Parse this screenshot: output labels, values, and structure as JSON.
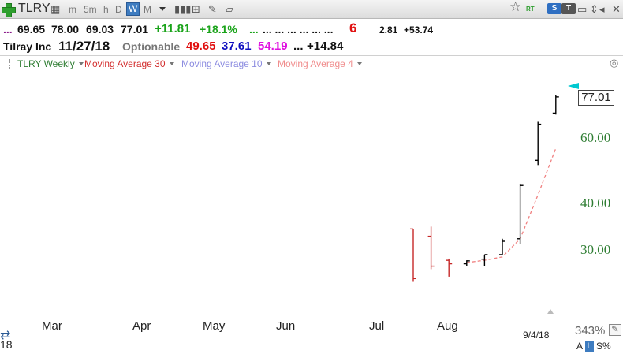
{
  "toolbar": {
    "symbol": "TLRY",
    "periods": [
      "m",
      "5m",
      "h",
      "D",
      "W",
      "M"
    ],
    "active_period": "W",
    "badges": {
      "rt": "RT",
      "s": "S",
      "t": "T"
    }
  },
  "quote": {
    "dots": "...",
    "open": "69.65",
    "high": "78.00",
    "low": "69.03",
    "close": "77.01",
    "change": "+11.81",
    "change_pct": "+18.1%",
    "dots_green": "...",
    "dots_mid": "... ... ... ... ... ...",
    "rank": "6",
    "val1": "2.81",
    "val2": "+53.74"
  },
  "info": {
    "company": "Tilray Inc",
    "date": "11/27/18",
    "tag": "Optionable",
    "v1": "49.65",
    "v2": "37.61",
    "v3": "54.19",
    "dots": "...",
    "v4": "+14.84"
  },
  "indicators": [
    {
      "label": "TLRY Weekly",
      "color": "#2e7d32"
    },
    {
      "label": "Moving Average 30",
      "color": "#d32f2f"
    },
    {
      "label": "Moving Average 10",
      "color": "#8c8ce0"
    },
    {
      "label": "Moving Average 4",
      "color": "#f08c8c"
    }
  ],
  "colors": {
    "up": "#000000",
    "down": "#c62828",
    "ma4": "#f08080",
    "axis_label": "#2e7d32",
    "price_marker": "#00c8d0",
    "green": "#1aa31a",
    "red": "#e01010",
    "blue": "#1010c0",
    "magenta": "#e010e0",
    "purple": "#8a1a8a"
  },
  "chart_data": {
    "type": "ohlc",
    "scale": "log",
    "ylim": [
      24,
      90
    ],
    "y_ticks": [
      "30.00",
      "40.00",
      "60.00"
    ],
    "x_month_labels": [
      "Mar",
      "Apr",
      "May",
      "Jun",
      "Jul",
      "Aug"
    ],
    "year_label": "18",
    "last_date_label": "9/4/18",
    "last_price": "77.01",
    "zoom": "343%",
    "bars": [
      {
        "week": "2018-07-19",
        "open": 34.0,
        "high": 33.0,
        "low": 24.5,
        "close": 25.0,
        "dir": "down"
      },
      {
        "week": "2018-07-26",
        "open": 32.5,
        "high": 34.5,
        "low": 26.5,
        "close": 27.0,
        "dir": "down"
      },
      {
        "week": "2018-08-02",
        "open": 28.0,
        "high": 28.3,
        "low": 25.3,
        "close": 27.4,
        "dir": "down"
      },
      {
        "week": "2018-08-09",
        "open": 27.4,
        "high": 28.0,
        "low": 27.0,
        "close": 27.9,
        "dir": "up"
      },
      {
        "week": "2018-08-16",
        "open": 28.2,
        "high": 29.0,
        "low": 27.0,
        "close": 29.0,
        "dir": "up"
      },
      {
        "week": "2018-08-23",
        "open": 29.0,
        "high": 32.0,
        "low": 29.0,
        "close": 31.5,
        "dir": "up"
      },
      {
        "week": "2018-08-30",
        "open": 32.0,
        "high": 45.0,
        "low": 31.0,
        "close": 44.5,
        "dir": "up"
      },
      {
        "week": "2018-09-06",
        "open": 52.0,
        "high": 66.0,
        "low": 50.5,
        "close": 65.0,
        "dir": "up"
      },
      {
        "week": "2018-09-13",
        "open": 69.65,
        "high": 78.0,
        "low": 69.03,
        "close": 77.01,
        "dir": "up"
      }
    ],
    "ma4": [
      {
        "week": "2018-08-09",
        "value": 27.6
      },
      {
        "week": "2018-08-16",
        "value": 28.0
      },
      {
        "week": "2018-08-23",
        "value": 28.6
      },
      {
        "week": "2018-08-30",
        "value": 32.0
      },
      {
        "week": "2018-09-06",
        "value": 42.0
      },
      {
        "week": "2018-09-13",
        "value": 56.0
      }
    ]
  }
}
